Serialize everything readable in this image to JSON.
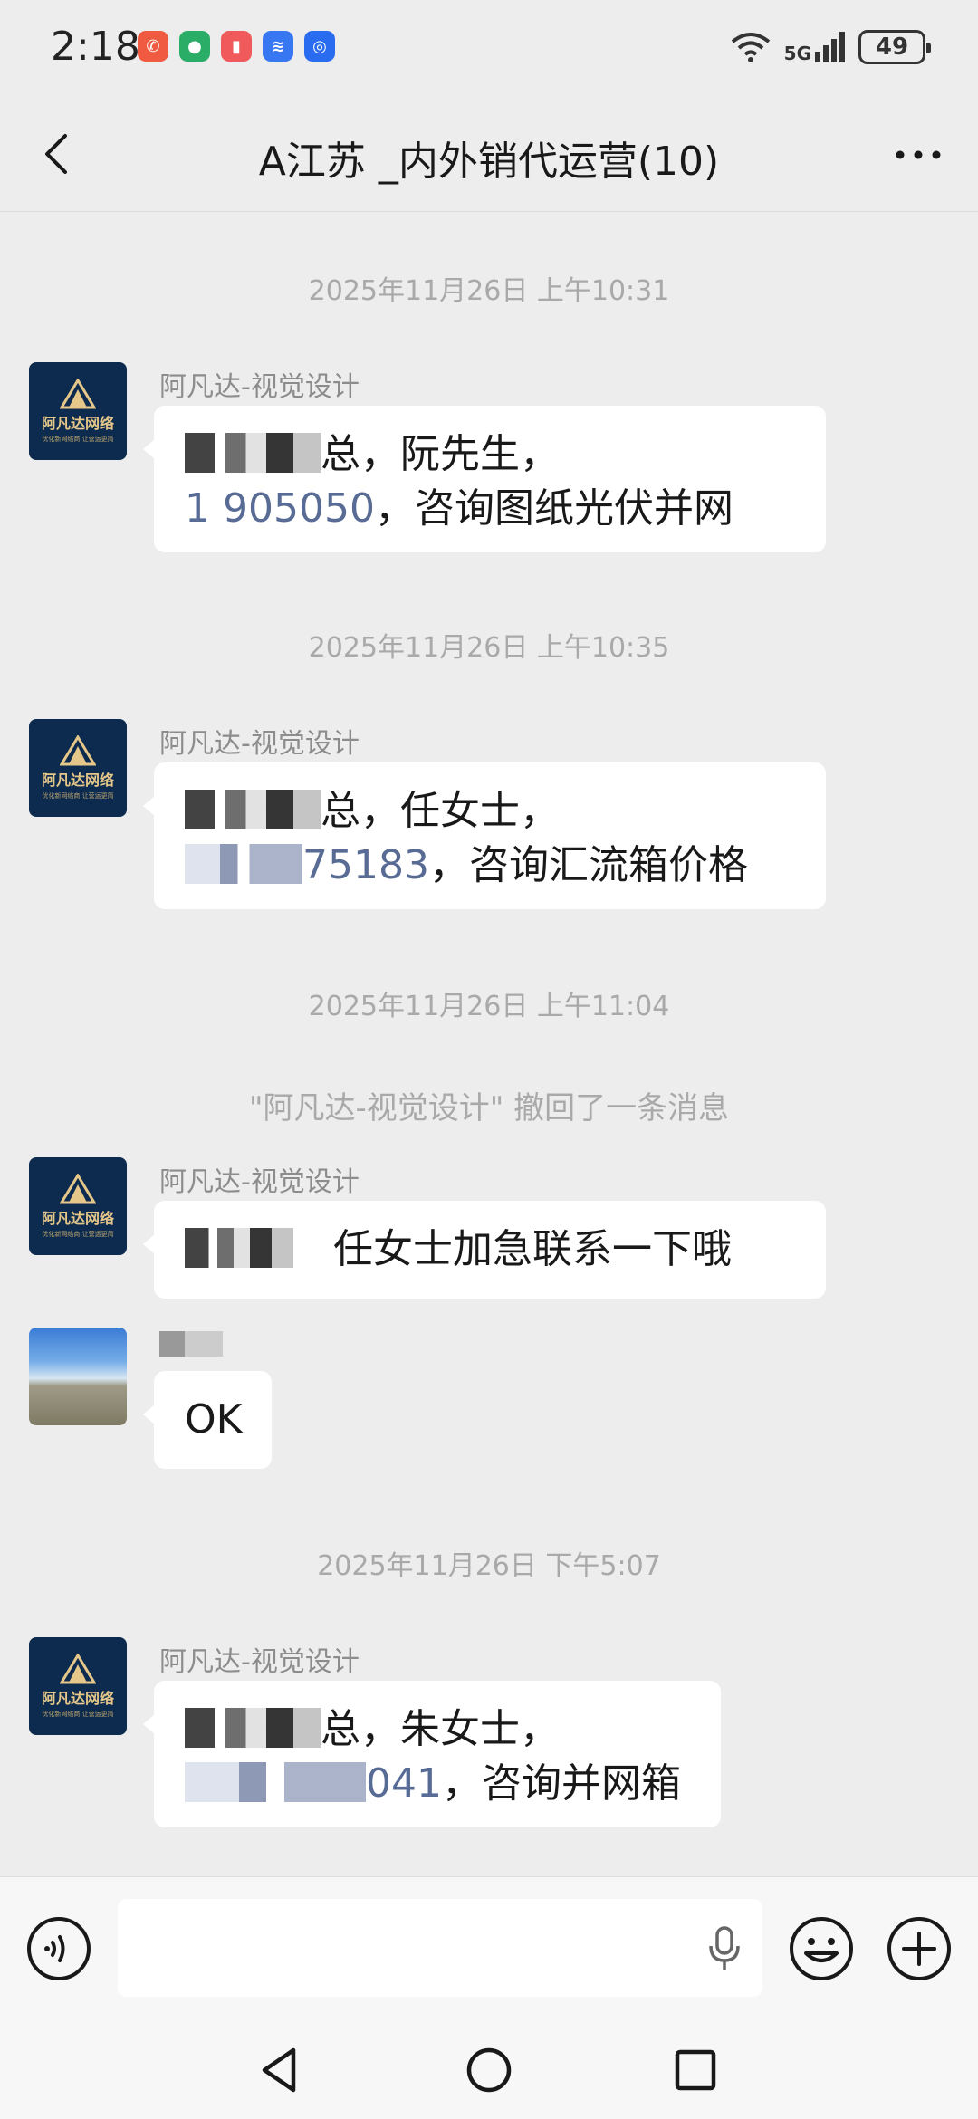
{
  "status_bar": {
    "time": "2:18",
    "network": "5G",
    "battery": "49"
  },
  "header": {
    "title": "A江苏  _内外销代运营(10)"
  },
  "messages": [
    {
      "timestamp": "2025年11月26日 上午10:31",
      "sender": "阿凡达-视觉设计",
      "line1_suffix": "总，阮先生，",
      "line2_phone": "1  905050",
      "line2_suffix": "，咨询图纸光伏并网"
    },
    {
      "timestamp": "2025年11月26日 上午10:35",
      "sender": "阿凡达-视觉设计",
      "line1_suffix": "总，任女士，",
      "line2_phone": "75183",
      "line2_suffix": "，咨询汇流箱价格"
    },
    {
      "timestamp": "2025年11月26日 上午11:04",
      "system": "\"阿凡达-视觉设计\" 撤回了一条消息",
      "sender": "阿凡达-视觉设计",
      "text": "任女士加急联系一下哦"
    },
    {
      "sender": "",
      "text": "OK"
    },
    {
      "timestamp": "2025年11月26日 下午5:07",
      "sender": "阿凡达-视觉设计",
      "line1_suffix": "总，朱女士，",
      "line2_phone": "041",
      "line2_suffix": "，咨询并网箱"
    }
  ],
  "brand_avatar": {
    "name": "阿凡达网络",
    "sub": "优化新网络商 让营运更简"
  },
  "icons": [
    "back-icon",
    "more-icon",
    "voice-icon",
    "mic-icon",
    "emoji-icon",
    "plus-icon",
    "nav-back-icon",
    "nav-home-icon",
    "nav-recents-icon"
  ]
}
